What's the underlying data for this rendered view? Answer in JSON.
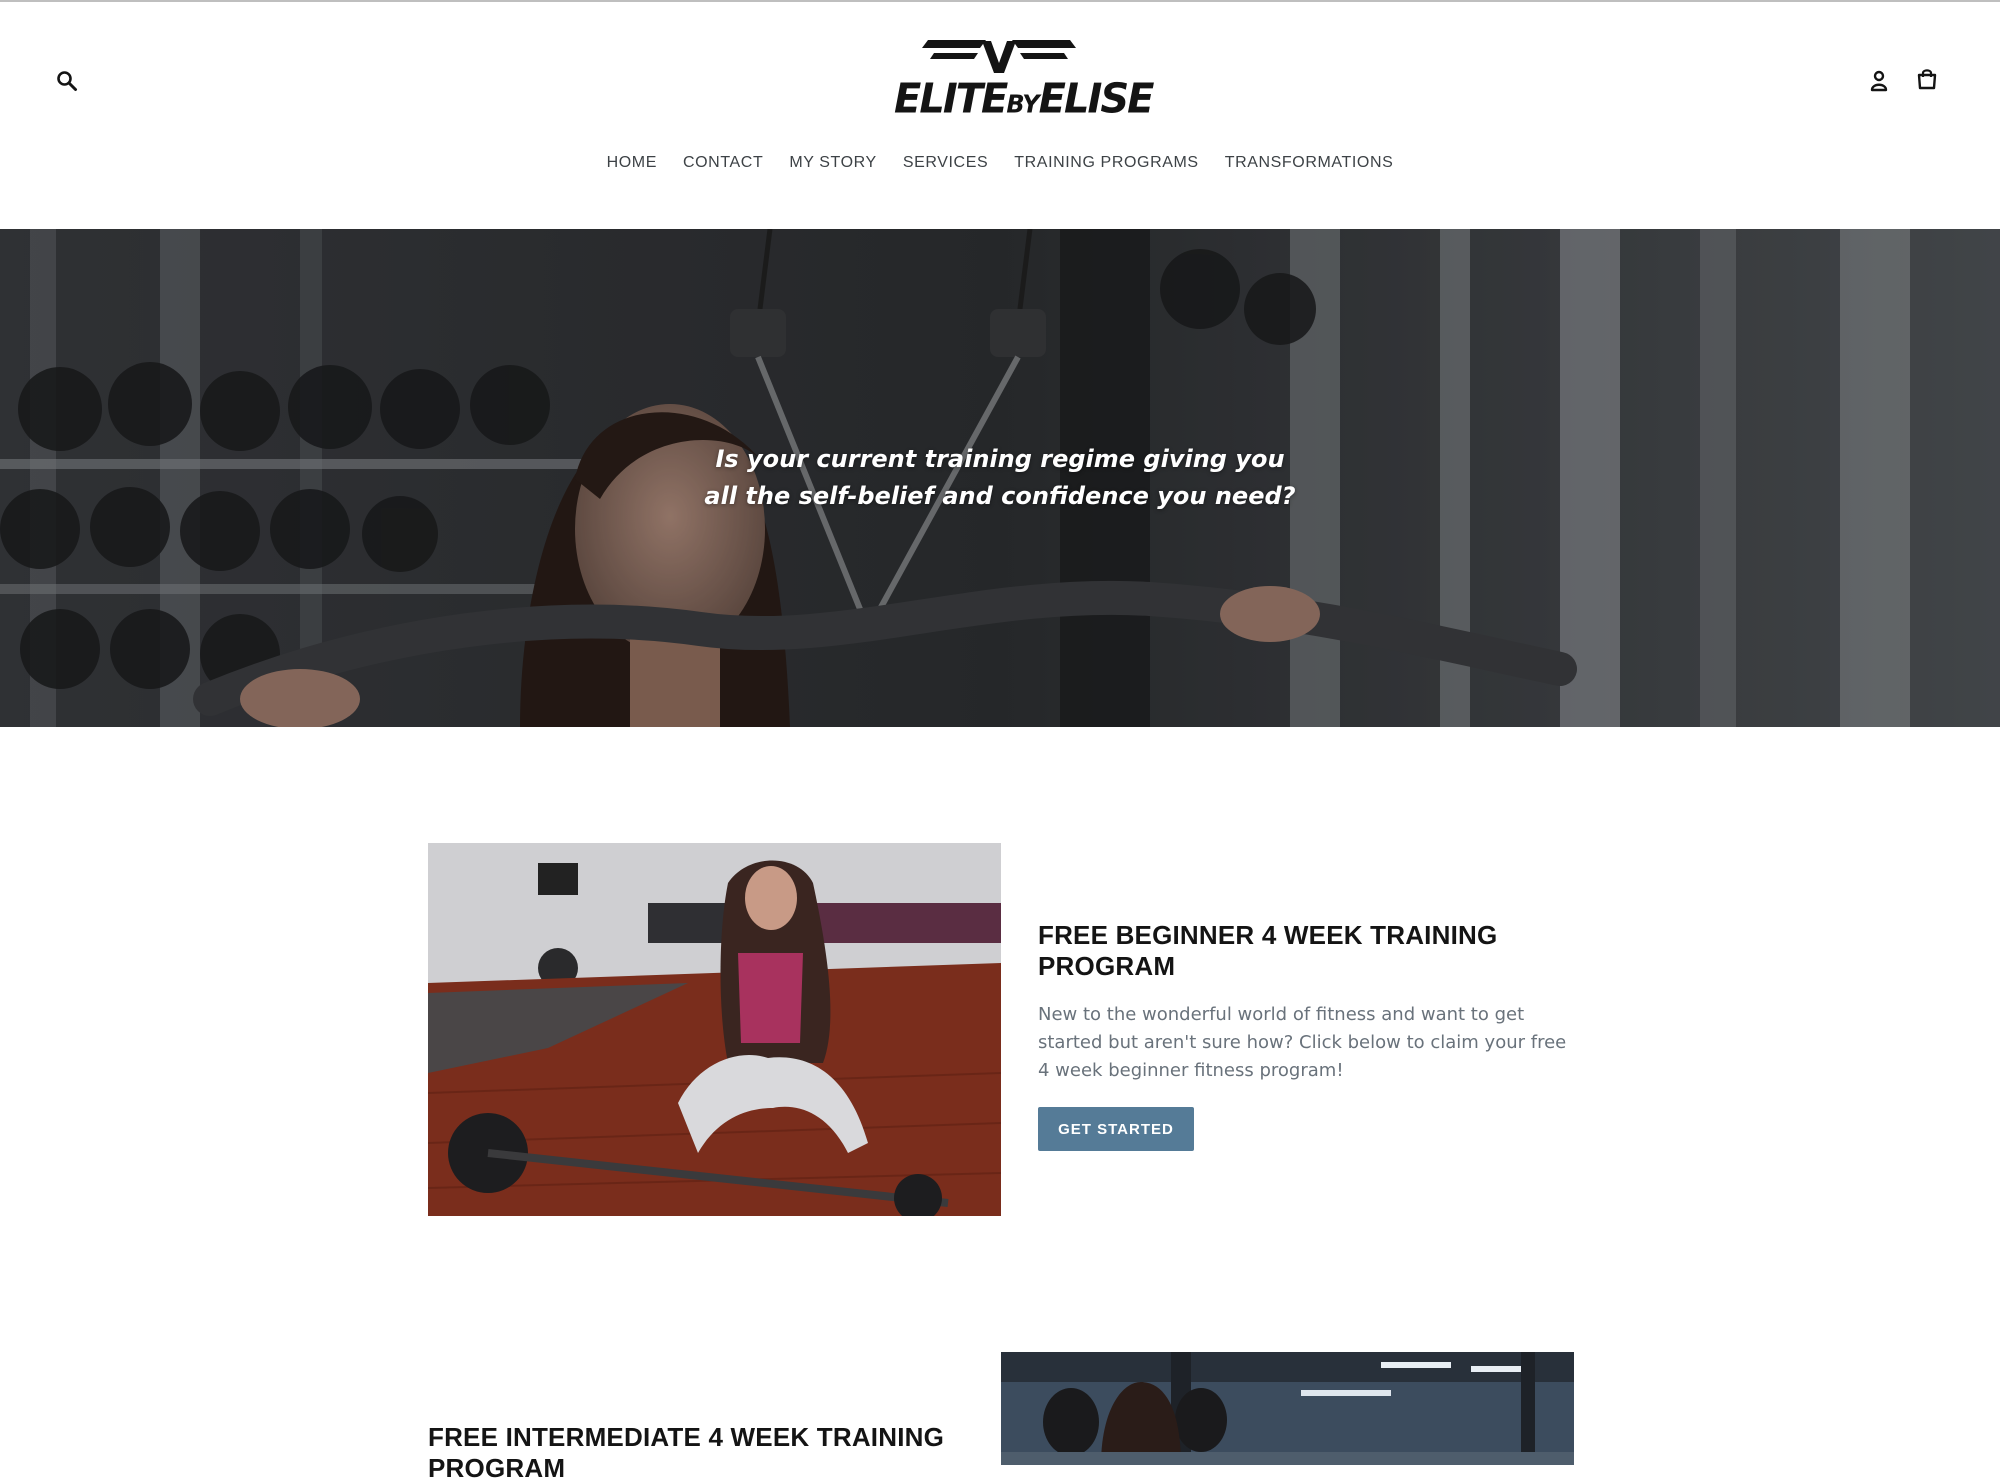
{
  "brand": {
    "logo_text_1": "ELITE",
    "logo_text_2": "BY",
    "logo_text_3": "ELISE"
  },
  "header": {
    "icons": {
      "search": "search-icon",
      "account": "account-icon",
      "cart": "cart-icon"
    }
  },
  "nav": {
    "items": [
      {
        "label": "HOME"
      },
      {
        "label": "CONTACT"
      },
      {
        "label": "MY STORY"
      },
      {
        "label": "SERVICES"
      },
      {
        "label": "TRAINING PROGRAMS"
      },
      {
        "label": "TRANSFORMATIONS"
      }
    ]
  },
  "hero": {
    "line_1": "Is your current training regime giving you",
    "line_2": "all the self-belief and confidence you need?"
  },
  "features": [
    {
      "title": "FREE BEGINNER 4 WEEK TRAINING PROGRAM",
      "text": "New to the wonderful world of fitness and want to get started but aren't sure how? Click below to claim your free 4 week beginner fitness program!",
      "button_label": "GET STARTED"
    },
    {
      "title": "FREE INTERMEDIATE 4 WEEK TRAINING PROGRAM"
    }
  ],
  "colors": {
    "accent": "#557b97",
    "heading": "#141414",
    "body_text": "#69727b",
    "nav_text": "#3d4246"
  }
}
